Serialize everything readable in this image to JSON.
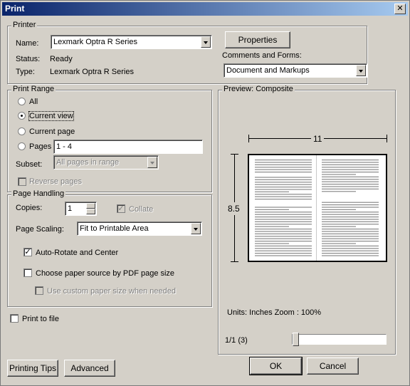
{
  "window": {
    "title": "Print",
    "close_glyph": "✕"
  },
  "printer": {
    "legend": "Printer",
    "name_label": "Name:",
    "name_value": "Lexmark Optra R Series",
    "status_label": "Status:",
    "status_value": "Ready",
    "type_label": "Type:",
    "type_value": "Lexmark Optra R Series",
    "properties_label": "Properties",
    "comments_label": "Comments and Forms:",
    "comments_value": "Document and Markups"
  },
  "print_range": {
    "legend": "Print Range",
    "all_label": "All",
    "current_view_label": "Current view",
    "current_page_label": "Current page",
    "pages_label": "Pages",
    "pages_value": "1 - 4",
    "subset_label": "Subset:",
    "subset_value": "All pages in range",
    "reverse_label": "Reverse pages",
    "selected": "current_view"
  },
  "page_handling": {
    "legend": "Page Handling",
    "copies_label": "Copies:",
    "copies_value": "1",
    "collate_label": "Collate",
    "scaling_label": "Page Scaling:",
    "scaling_value": "Fit to Printable Area",
    "auto_rotate_label": "Auto-Rotate and Center",
    "auto_rotate_checked": true,
    "paper_source_label": "Choose paper source by PDF page size",
    "paper_source_checked": false,
    "custom_paper_label": "Use custom paper size when needed"
  },
  "print_to_file_label": "Print to file",
  "preview": {
    "legend": "Preview: Composite",
    "width_value": "11",
    "height_value": "8.5",
    "units_text": "Units: Inches Zoom : 100%",
    "page_counter": "1/1 (3)",
    "slider_position": 0
  },
  "buttons": {
    "printing_tips": "Printing Tips",
    "advanced": "Advanced",
    "ok": "OK",
    "cancel": "Cancel"
  }
}
